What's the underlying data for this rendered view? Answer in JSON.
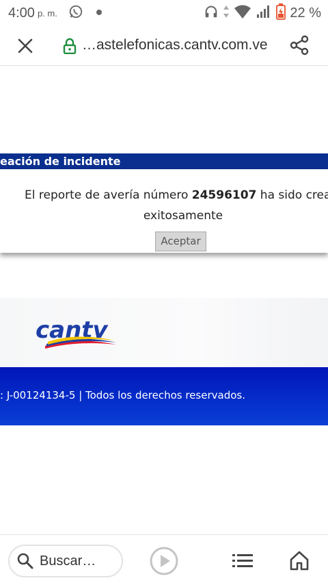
{
  "status_bar": {
    "time": "4:00",
    "ampm": "p. m.",
    "battery": "22 %"
  },
  "browser": {
    "url": "…astelefonicas.cantv.com.ve"
  },
  "incident": {
    "header": "eación de incidente",
    "msg_prefix": "El reporte de avería número ",
    "ticket_number": "24596107",
    "msg_suffix": " ha sido crea",
    "msg_line2": "exitosamente",
    "accept_label": "Aceptar"
  },
  "logo": {
    "text": "cantv"
  },
  "footer": {
    "text": ": J-00124134-5 | Todos los derechos reservados."
  },
  "bottom_nav": {
    "search_label": "Buscar…"
  },
  "colors": {
    "header_blue": "#0a2f8e",
    "footer_blue": "#0016b8",
    "lock_green": "#1e8e3e",
    "logo_blue": "#1d3fa6"
  }
}
